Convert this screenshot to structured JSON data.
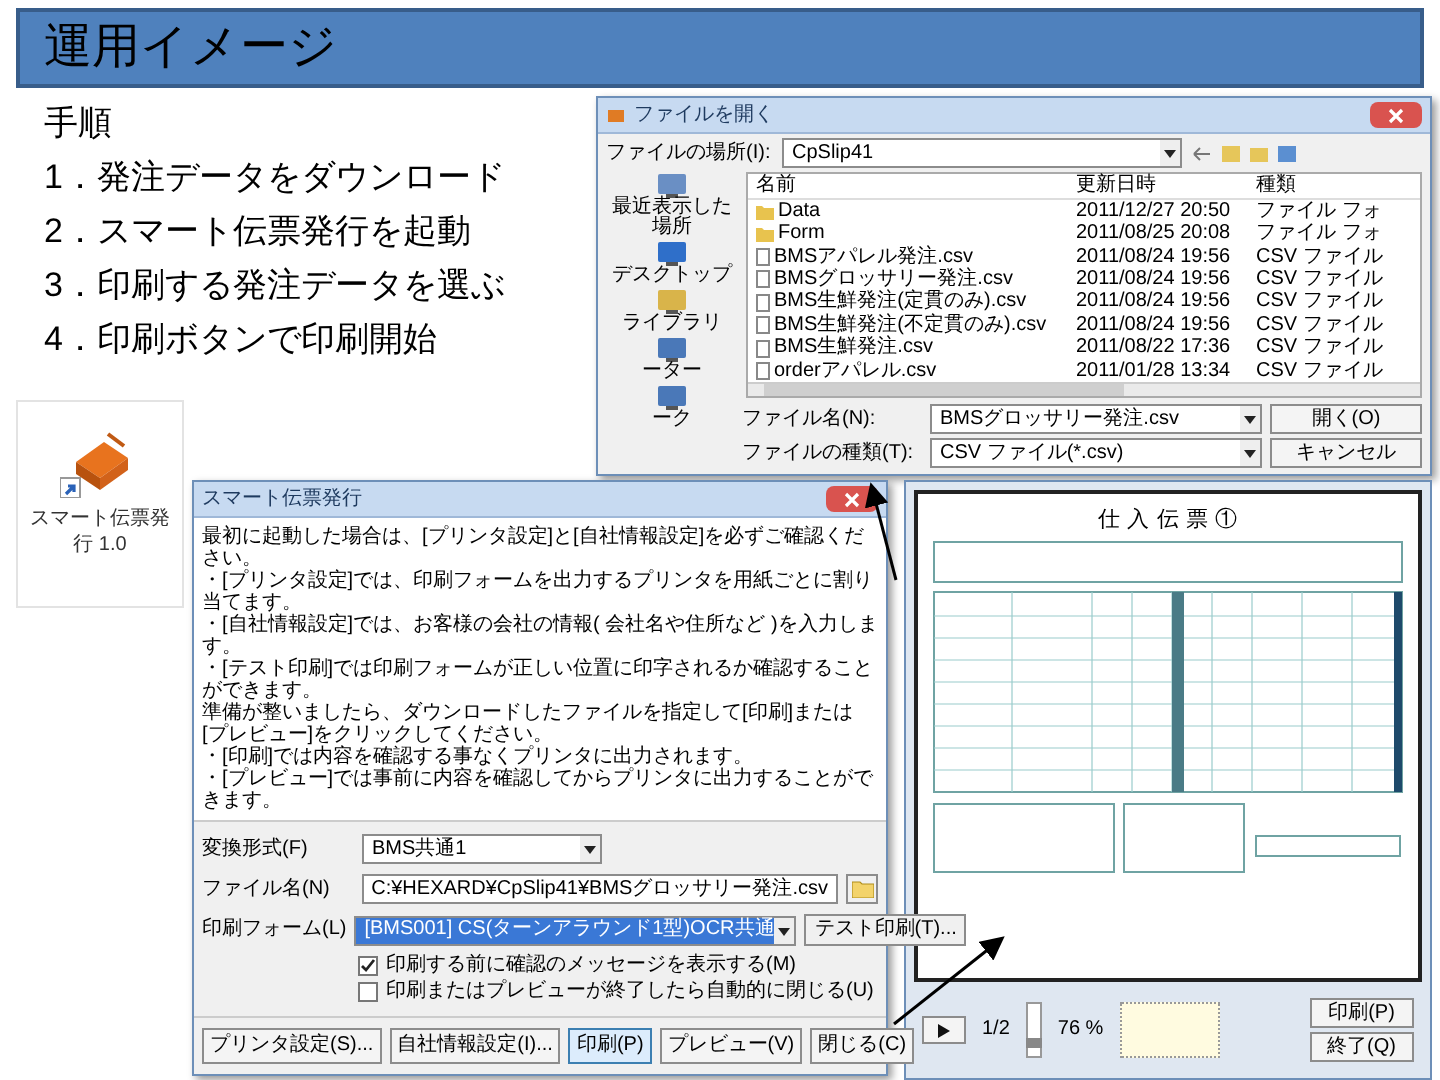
{
  "slide_title": "運用イメージ",
  "steps_heading": "手順",
  "steps": [
    "1．発注データをダウンロード",
    "2．スマート伝票発行を起動",
    "3．印刷する発注データを選ぶ",
    "4．印刷ボタンで印刷開始"
  ],
  "app_icon": {
    "label": "スマート伝票発行 1.0"
  },
  "print_dialog": {
    "title": "スマート伝票発行",
    "message": [
      "最初に起動した場合は、[プリンタ設定]と[自社情報設定]を必ずご確認ください。",
      "・[プリンタ設定]では、印刷フォームを出力するプリンタを用紙ごとに割り当てます。",
      "・[自社情報設定]では、お客様の会社の情報( 会社名や住所など )を入力します。",
      "・[テスト印刷]では印刷フォームが正しい位置に印字されるか確認することができます。",
      "準備が整いましたら、ダウンロードしたファイルを指定して[印刷]または[プレビュー]をクリックしてください。",
      "・[印刷]では内容を確認する事なくプリンタに出力されます。",
      "・[プレビュー]では事前に内容を確認してからプリンタに出力することができます。"
    ],
    "fields": [
      {
        "kind": "dropdown",
        "label": "変換形式(F)",
        "value": "BMS共通1"
      },
      {
        "kind": "file",
        "label": "ファイル名(N)",
        "value": "C:¥HEXARD¥CpSlip41¥BMSグロッサリー発注.csv"
      },
      {
        "kind": "form",
        "label": "印刷フォーム(L)",
        "value": "[BMS001] CS(ターンアラウンド1型)OCR共通",
        "button": "テスト印刷(T)..."
      }
    ],
    "checkboxes": [
      {
        "label": "印刷する前に確認のメッセージを表示する(M)",
        "checked": true
      },
      {
        "label": "印刷またはプレビューが終了したら自動的に閉じる(U)",
        "checked": false
      }
    ],
    "buttons": [
      {
        "label": "プリンタ設定(S)...",
        "selected": false
      },
      {
        "label": "自社情報設定(I)...",
        "selected": false
      },
      {
        "label": "印刷(P)",
        "selected": true
      },
      {
        "label": "プレビュー(V)",
        "selected": false
      },
      {
        "label": "閉じる(C)",
        "selected": false
      }
    ]
  },
  "file_dialog": {
    "title": "ファイルを開く",
    "location_label": "ファイルの場所(I):",
    "location": "CpSlip41",
    "places": [
      "最近表示した場所",
      "デスクトップ",
      "ライブラリ",
      "ーター",
      "ーク"
    ],
    "columns": [
      "名前",
      "更新日時",
      "種類"
    ],
    "rows": [
      {
        "kind": "folder",
        "name": "Data",
        "modified": "2011/12/27 20:50",
        "type": "ファイル フォ"
      },
      {
        "kind": "folder",
        "name": "Form",
        "modified": "2011/08/25 20:08",
        "type": "ファイル フォ"
      },
      {
        "kind": "file",
        "name": "BMSアパレル発注.csv",
        "modified": "2011/08/24 19:56",
        "type": "CSV ファイル"
      },
      {
        "kind": "file",
        "name": "BMSグロッサリー発注.csv",
        "modified": "2011/08/24 19:56",
        "type": "CSV ファイル"
      },
      {
        "kind": "file",
        "name": "BMS生鮮発注(定貫のみ).csv",
        "modified": "2011/08/24 19:56",
        "type": "CSV ファイル"
      },
      {
        "kind": "file",
        "name": "BMS生鮮発注(不定貫のみ).csv",
        "modified": "2011/08/24 19:56",
        "type": "CSV ファイル"
      },
      {
        "kind": "file",
        "name": "BMS生鮮発注.csv",
        "modified": "2011/08/22 17:36",
        "type": "CSV ファイル"
      },
      {
        "kind": "file",
        "name": "orderアパレル.csv",
        "modified": "2011/01/28 13:34",
        "type": "CSV ファイル"
      }
    ],
    "filename_label": "ファイル名(N):",
    "filename": "BMSグロッサリー発注.csv",
    "open_button": "開く(O)",
    "filetype_label": "ファイルの種類(T):",
    "filetype": "CSV ファイル(*.csv)",
    "cancel_button": "キャンセル"
  },
  "preview": {
    "document_title": "仕 入 伝 票 ①",
    "page": "1/2",
    "zoom_slider": {
      "level": 0.2
    },
    "zoom": "76 %",
    "buttons": [
      "印刷(P)",
      "終了(Q)"
    ]
  }
}
